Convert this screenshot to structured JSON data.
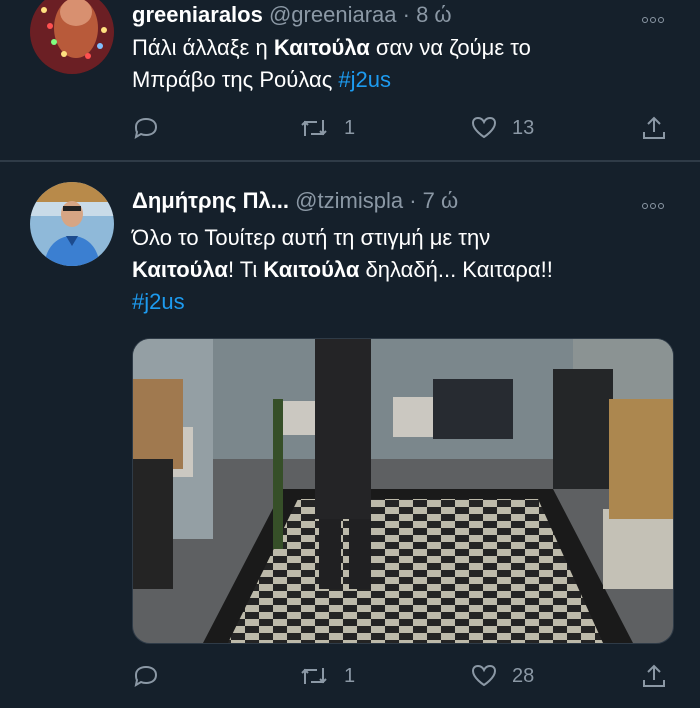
{
  "tweets": [
    {
      "name": "greeniaralos",
      "handle": "@greeniaraa",
      "dot": "·",
      "time": "8 ώ",
      "text_parts": [
        "Πάλι άλλαξε η ",
        "Καιτούλα",
        " σαν να ζούμε το",
        "Μπράβο της Ρούλας ",
        "#j2us"
      ],
      "reply_count": "",
      "retweet_count": "1",
      "like_count": "13"
    },
    {
      "name": "Δημήτρης Πλ...",
      "handle": "@tzimispla",
      "dot": "·",
      "time": "7 ώ",
      "text_parts": [
        "Όλο το Τουίτερ αυτή τη στιγμή με την",
        "Καιτούλα",
        "! Τι ",
        "Καιτούλα",
        " δηλαδή... Καιταρα!!",
        "#j2us"
      ],
      "reply_count": "",
      "retweet_count": "1",
      "like_count": "28"
    }
  ],
  "icons": {
    "reply": "reply-icon",
    "retweet": "retweet-icon",
    "like": "heart-icon",
    "share": "share-icon",
    "more": "more-icon"
  },
  "colors": {
    "background": "#15202b",
    "secondary_text": "#8b98a5",
    "link": "#1d9bf0"
  }
}
